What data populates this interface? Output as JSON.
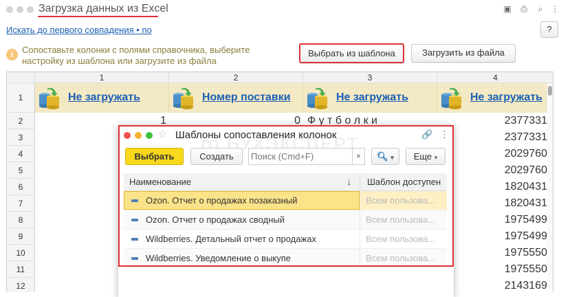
{
  "window": {
    "title": "Загрузка данных из Excel"
  },
  "toolbar": {
    "search_link": "Искать до первого совпадения • по",
    "help_label": "?"
  },
  "hint": {
    "line1": "Сопоставьте колонки с полями справочника, выберите",
    "line2": "настройку из шаблона или загрузите из файла"
  },
  "buttons": {
    "choose_template": "Выбрать из шаблона",
    "load_file": "Загрузить из файла"
  },
  "grid": {
    "col_headers": [
      "1",
      "2",
      "3",
      "4"
    ],
    "row1_label": "1",
    "mapping": [
      "Не загружать",
      "Номер поставки",
      "Не загружать",
      "Не загружать"
    ],
    "row_numbers": [
      "2",
      "3",
      "4",
      "5",
      "6",
      "7",
      "8",
      "9",
      "10",
      "11",
      "12"
    ],
    "row2": {
      "c1": "1",
      "c2": "0",
      "c3": "Ф у т б о л к и"
    },
    "col4_values": [
      "2377331",
      "2377331",
      "2029760",
      "2029760",
      "1820431",
      "1820431",
      "1975499",
      "1975499",
      "1975550",
      "1975550",
      "2143169"
    ]
  },
  "dialog": {
    "title": "Шаблоны сопоставления колонок",
    "watermark": "БУХЭКСПЕРТ",
    "select_label": "Выбрать",
    "create_label": "Создать",
    "search_placeholder": "Поиск (Cmd+F)",
    "clear_label": "×",
    "more_label": "Еще",
    "col_name": "Наименование",
    "col_sort": "↓",
    "col_access": "Шаблон доступен",
    "rows": [
      {
        "name": "Ozon. Отчет о продажах позаказный",
        "access": "Всем пользова..."
      },
      {
        "name": "Ozon. Отчет о продажах сводный",
        "access": "Всем пользова..."
      },
      {
        "name": "Wildberries. Детальный отчет о продажах",
        "access": "Всем пользова..."
      },
      {
        "name": "Wildberries. Уведомление о выкупе",
        "access": "Всем пользова..."
      }
    ]
  },
  "colors": {
    "accent_red": "#e0303a",
    "select_yellow": "#f7d81c",
    "link_blue": "#1a5fb4",
    "mapping_row_bg": "#f3e9c4"
  }
}
